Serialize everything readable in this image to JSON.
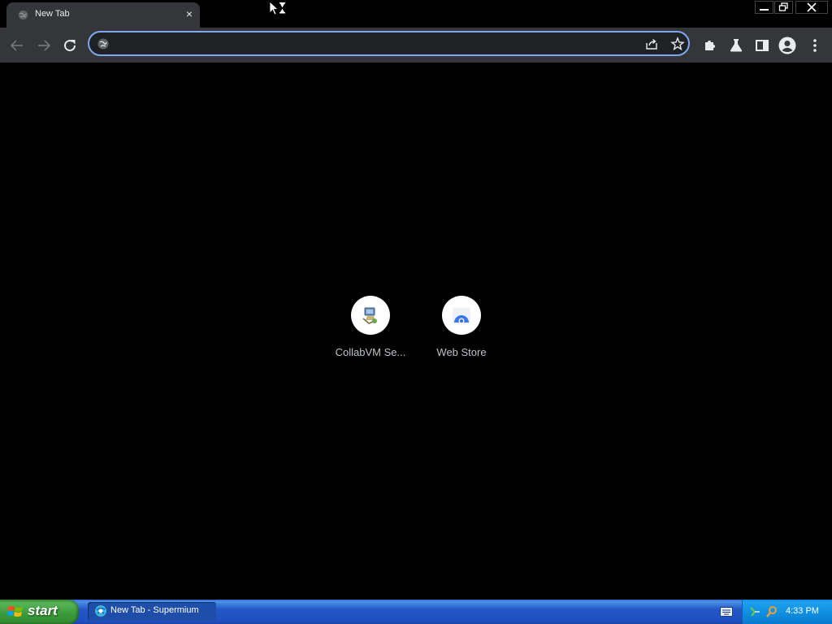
{
  "tab": {
    "title": "New Tab",
    "close": "×"
  },
  "omnibox": {
    "value": "",
    "placeholder": ""
  },
  "shortcuts": [
    {
      "label": "CollabVM Se...",
      "icon": "collabvm-icon"
    },
    {
      "label": "Web Store",
      "icon": "web-store-icon"
    }
  ],
  "taskbar": {
    "start_label": "start",
    "task_label": "New Tab - Supermium",
    "clock": "4:33 PM"
  },
  "colors": {
    "page_bg": "#000000",
    "toolbar_bg": "#35363a",
    "omnibox_border": "#7ea7f0",
    "taskbar_blue": "#245edb",
    "start_green": "#3c9a3c"
  }
}
